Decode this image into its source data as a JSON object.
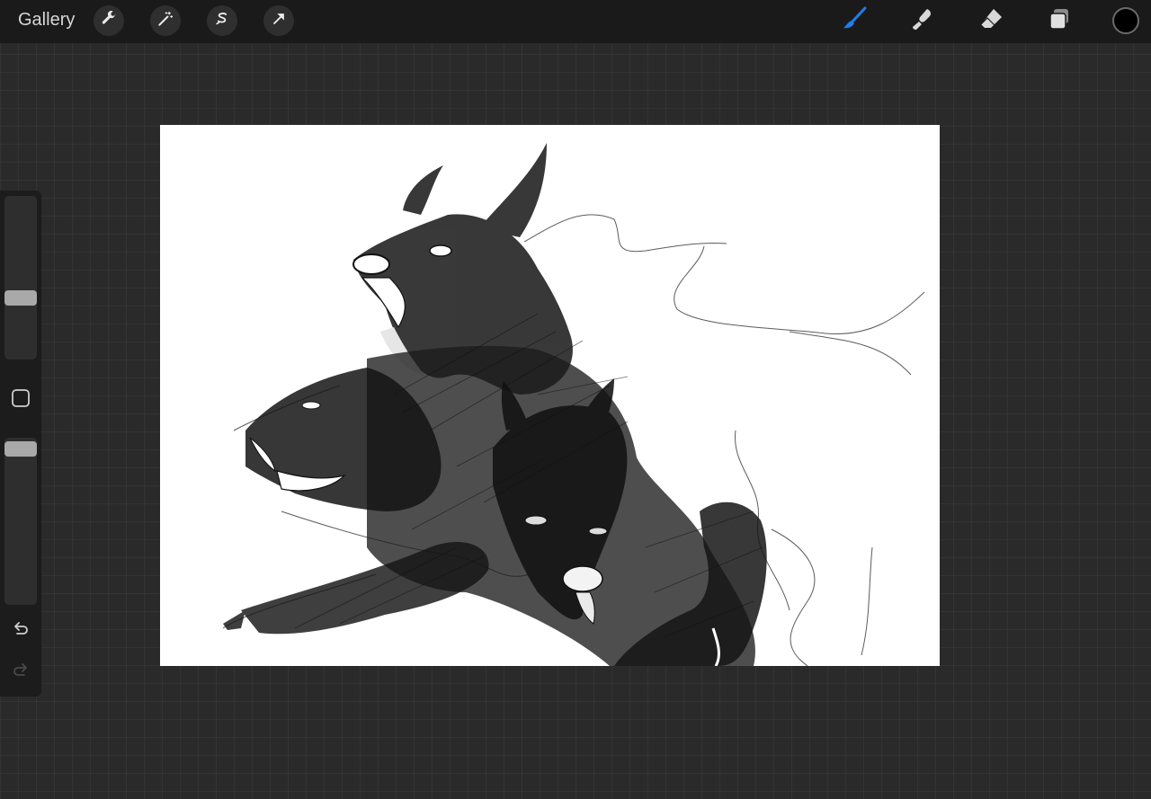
{
  "topbar": {
    "gallery_label": "Gallery",
    "left_tools": [
      "wrench-icon",
      "magic-wand-icon",
      "selection-icon",
      "transform-arrow-icon"
    ],
    "right_tools": [
      "brush-icon",
      "smudge-icon",
      "eraser-icon",
      "layers-icon"
    ],
    "active_tool": "brush",
    "accent_color": "#1f7ee8",
    "current_color": "#000000"
  },
  "sidebar": {
    "brush_size_level": 0.5,
    "opacity_level": 0.05,
    "icons": [
      "modify-square-icon",
      "undo-icon",
      "redo-icon"
    ]
  },
  "canvas": {
    "background_color": "#ffffff",
    "ink_color": "#111111"
  }
}
